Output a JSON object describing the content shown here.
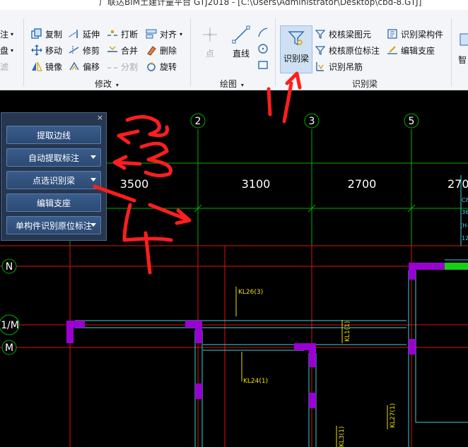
{
  "window": {
    "title": "广联达BIM土建计量平台 GTJ2018 - [C:\\Users\\Administrator\\Desktop\\cbd-8.GTJ]"
  },
  "ribbon": {
    "left_partial": [
      "注",
      "盘",
      "滤"
    ],
    "modify": {
      "items": [
        "复制",
        "延伸",
        "打断",
        "对齐",
        "移动",
        "修剪",
        "合并",
        "删除",
        "镜像",
        "偏移",
        "分割",
        "旋转"
      ],
      "label": "修改"
    },
    "draw": {
      "point": "点",
      "line": "直线",
      "label": "绘图"
    },
    "recognize": {
      "main": "识别梁",
      "items": [
        "校核梁图元",
        "识别梁构件",
        "校核原位标注",
        "编辑支座",
        "识别吊筋"
      ],
      "label": "识别梁"
    },
    "right_partial": "智"
  },
  "panel": {
    "close": "×",
    "buttons": [
      "提取边线",
      "自动提取标注",
      "点选识别梁",
      "编辑支座",
      "单构件识别原位标注"
    ]
  },
  "drawing": {
    "axes_top": [
      "2",
      "3",
      "5"
    ],
    "axes_left": [
      "N",
      "1/M",
      "M"
    ],
    "dims": [
      "3500",
      "3100",
      "2700",
      "270"
    ],
    "beam_labels": [
      "KL26(3)",
      "KL24(1)",
      "KL1(1)",
      "KL27(1)",
      "KL3(1)"
    ],
    "right_text": [
      "C8",
      "36",
      "(H-",
      "12"
    ]
  },
  "annotations": [
    "1",
    "2",
    "3",
    "4"
  ],
  "colors": {
    "accent": "#2c4a73",
    "grid": "#00c000",
    "beam": "#9b00d3",
    "wall": "#ff2a2a",
    "annot": "#ff2020"
  }
}
